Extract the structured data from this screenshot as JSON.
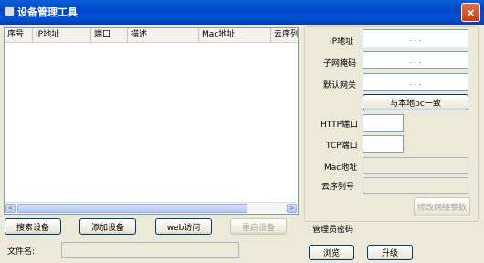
{
  "window": {
    "title": "设备管理工具",
    "close_glyph": "×"
  },
  "device_list": {
    "columns": [
      "序号",
      "IP地址",
      "端口",
      "描述",
      "Mac地址",
      "云序列号"
    ],
    "rows": [],
    "scroll_left_glyph": "<",
    "scroll_right_glyph": ">"
  },
  "buttons": {
    "search": "搜索设备",
    "add": "添加设备",
    "web": "web访问",
    "restart": "重启设备",
    "same_as_pc": "与本地pc一致",
    "modify_network": "修改网络参数",
    "browse": "浏览",
    "upgrade": "升级"
  },
  "network": {
    "ip_label": "IP地址",
    "mask_label": "子网掩码",
    "gateway_label": "默认网关",
    "http_label": "HTTP端口",
    "tcp_label": "TCP端口",
    "mac_label": "Mac地址",
    "serial_label": "云序列号",
    "ip_dots": ".   .   .",
    "mask_dots": ".   .   .",
    "gateway_dots": ".   .   .",
    "http_value": "",
    "tcp_value": "",
    "mac_value": "",
    "serial_value": ""
  },
  "admin_password_label": "管理员密码",
  "file": {
    "label": "文件名:",
    "value": ""
  }
}
